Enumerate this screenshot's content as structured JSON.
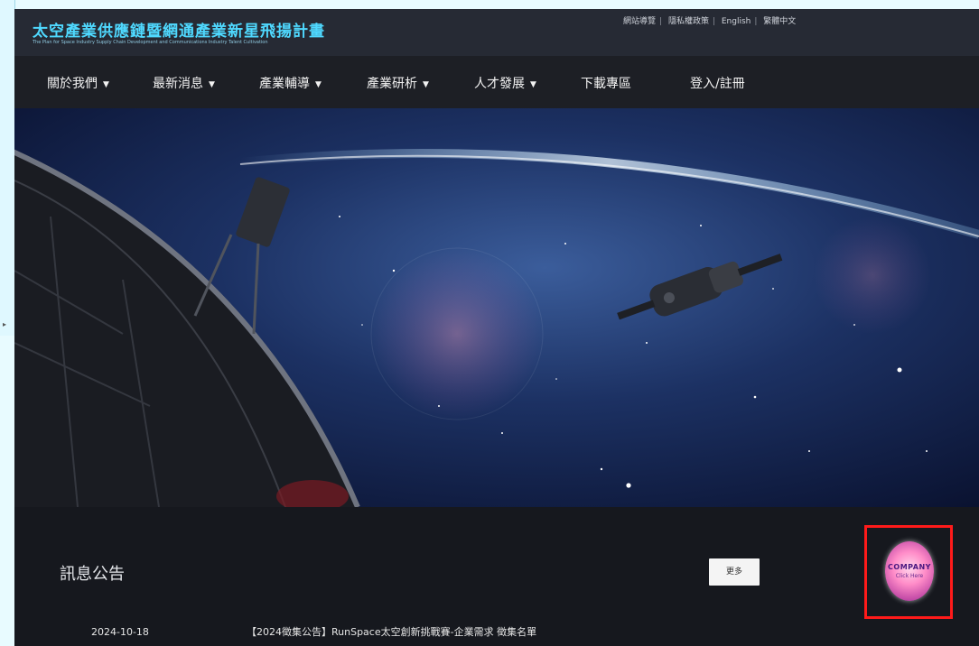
{
  "header": {
    "title": "太空產業供應鏈暨網通產業新星飛揚計畫",
    "subtitle": "The Plan for Space Industry Supply Chain Development and Communications Industry Talent Cultivation",
    "top_links": [
      "網站導覽",
      "隱私權政策",
      "English",
      "繁體中文"
    ]
  },
  "nav": {
    "items": [
      {
        "label": "關於我們",
        "dropdown": true
      },
      {
        "label": "最新消息",
        "dropdown": true
      },
      {
        "label": "產業輔導",
        "dropdown": true
      },
      {
        "label": "產業研析",
        "dropdown": true
      },
      {
        "label": "人才發展",
        "dropdown": true
      },
      {
        "label": "下載專區",
        "dropdown": false
      },
      {
        "label": "登入/註冊",
        "dropdown": false
      }
    ],
    "caret": "▼"
  },
  "news": {
    "section_title": "訊息公告",
    "more_label": "更多",
    "items": [
      {
        "date": "2024-10-18",
        "title": "【2024徵集公告】RunSpace太空創新挑戰賽-企業需求 徵集名單"
      }
    ]
  },
  "company_badge": {
    "label": "COMPANY",
    "sublabel": "Click Here"
  },
  "colors": {
    "header_bg": "#262a34",
    "nav_bg": "#1d1f25",
    "title_color": "#4fd9ff",
    "highlight_border": "#ff1a1a"
  }
}
